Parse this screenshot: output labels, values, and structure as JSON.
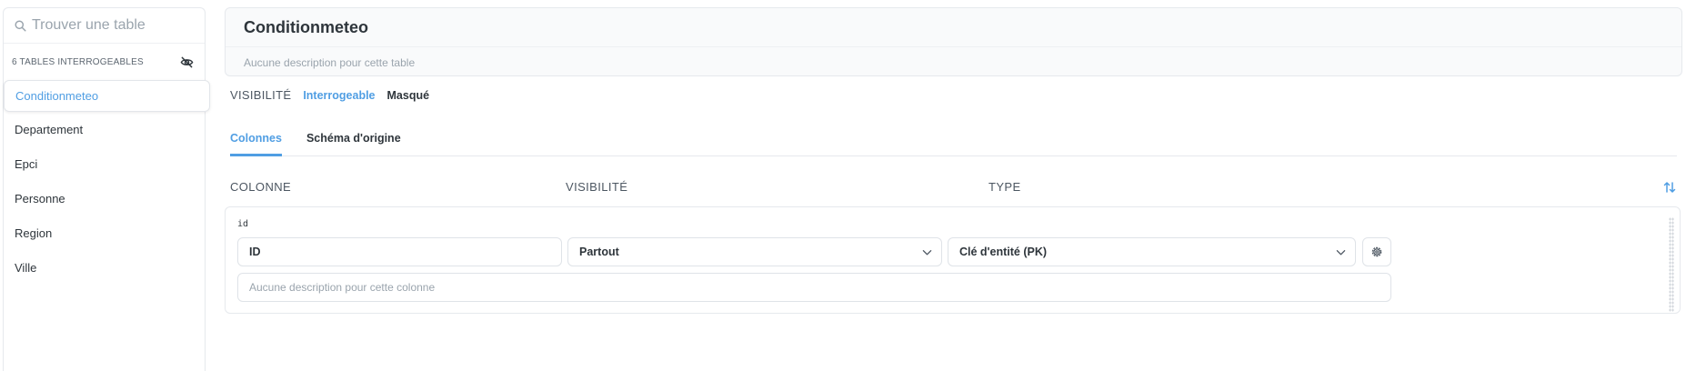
{
  "sidebar": {
    "search_placeholder": "Trouver une table",
    "count_label": "6 TABLES INTERROGEABLES",
    "items": [
      {
        "label": "Conditionmeteo"
      },
      {
        "label": "Departement"
      },
      {
        "label": "Epci"
      },
      {
        "label": "Personne"
      },
      {
        "label": "Region"
      },
      {
        "label": "Ville"
      }
    ],
    "active_index": 0
  },
  "header": {
    "title": "Conditionmeteo",
    "description_placeholder": "Aucune description pour cette table"
  },
  "visibility": {
    "label": "VISIBILITÉ",
    "options": [
      "Interrogeable",
      "Masqué"
    ],
    "selected": "Interrogeable"
  },
  "tabs": [
    {
      "label": "Colonnes",
      "active": true
    },
    {
      "label": "Schéma d'origine",
      "active": false
    }
  ],
  "columns_header": {
    "column": "COLONNE",
    "visibility": "VISIBILITÉ",
    "type": "TYPE"
  },
  "fields": [
    {
      "name": "id",
      "display_name": "ID",
      "visibility": "Partout",
      "type": "Clé d'entité (PK)",
      "description_placeholder": "Aucune description pour cette colonne"
    }
  ],
  "colors": {
    "accent": "#509ee3",
    "text_dark": "#2e353b",
    "text_light": "#9aa4ad",
    "border": "#e6e9ed"
  }
}
